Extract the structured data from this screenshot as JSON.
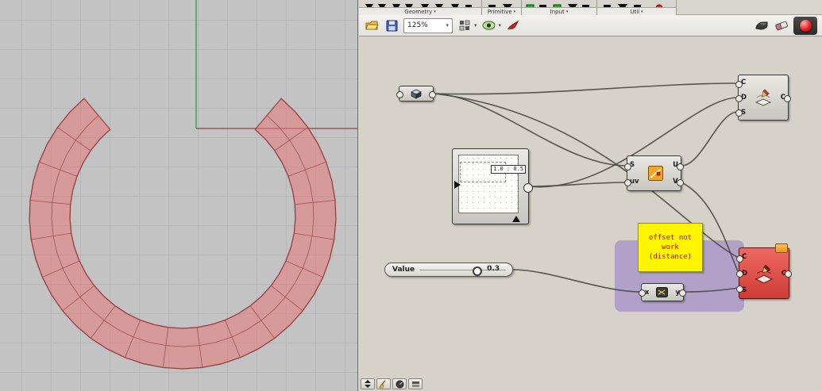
{
  "glyphs": {
    "dropdown": "▾"
  },
  "tabs": {
    "groups": [
      {
        "label": "Geometry"
      },
      {
        "label": "Primitive"
      },
      {
        "label": "Input"
      },
      {
        "label": "Util"
      }
    ]
  },
  "toolbar": {
    "zoom": "125%"
  },
  "canvas": {
    "mdslider": {
      "readout": "1.0 : 0.5"
    },
    "eval": {
      "in1": "S",
      "in2": "uv",
      "out1": "U",
      "out2": "V"
    },
    "note": {
      "line1": "offset not work",
      "line2": "(distance)"
    },
    "xy": {
      "in": "x",
      "out": "y"
    },
    "offset_top": {
      "in1": "C",
      "in2": "D",
      "in3": "S",
      "out": "C"
    },
    "offset_err": {
      "in1": "C",
      "in2": "D",
      "in3": "S",
      "out": "C"
    },
    "slider": {
      "label": "Value",
      "value": "0.3"
    }
  },
  "colors": {
    "panel_yellow": "#fff500",
    "note_text": "#cc0000",
    "group_purple": "#9479c9",
    "error_node": "#d84040",
    "solver_ball": "#ee1c1c"
  }
}
